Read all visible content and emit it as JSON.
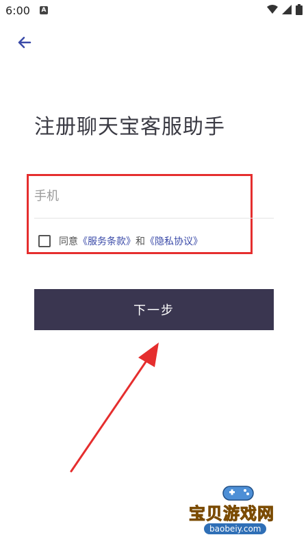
{
  "status_bar": {
    "time": "6:00",
    "notification_icon": "a-letter-icon",
    "wifi_icon": "wifi-icon",
    "signal_icon": "signal-icon",
    "battery_icon": "battery-icon"
  },
  "header": {
    "back_icon": "arrow-left-icon",
    "title": "注册聊天宝客服助手"
  },
  "form": {
    "phone_placeholder": "手机",
    "phone_value": "",
    "agree_prefix": "同意",
    "terms_link": "《服务条款》",
    "agree_conjunction": "和",
    "privacy_link": "《隐私协议》",
    "agreed": false
  },
  "actions": {
    "next_label": "下一步"
  },
  "annotations": {
    "highlight_color": "#e52e2e",
    "arrow_color": "#e52e2e"
  },
  "watermark": {
    "text": "宝贝游戏网",
    "domain": "baobeiy.com"
  },
  "colors": {
    "accent": "#3a4aa8",
    "button_bg": "#3a3650"
  }
}
